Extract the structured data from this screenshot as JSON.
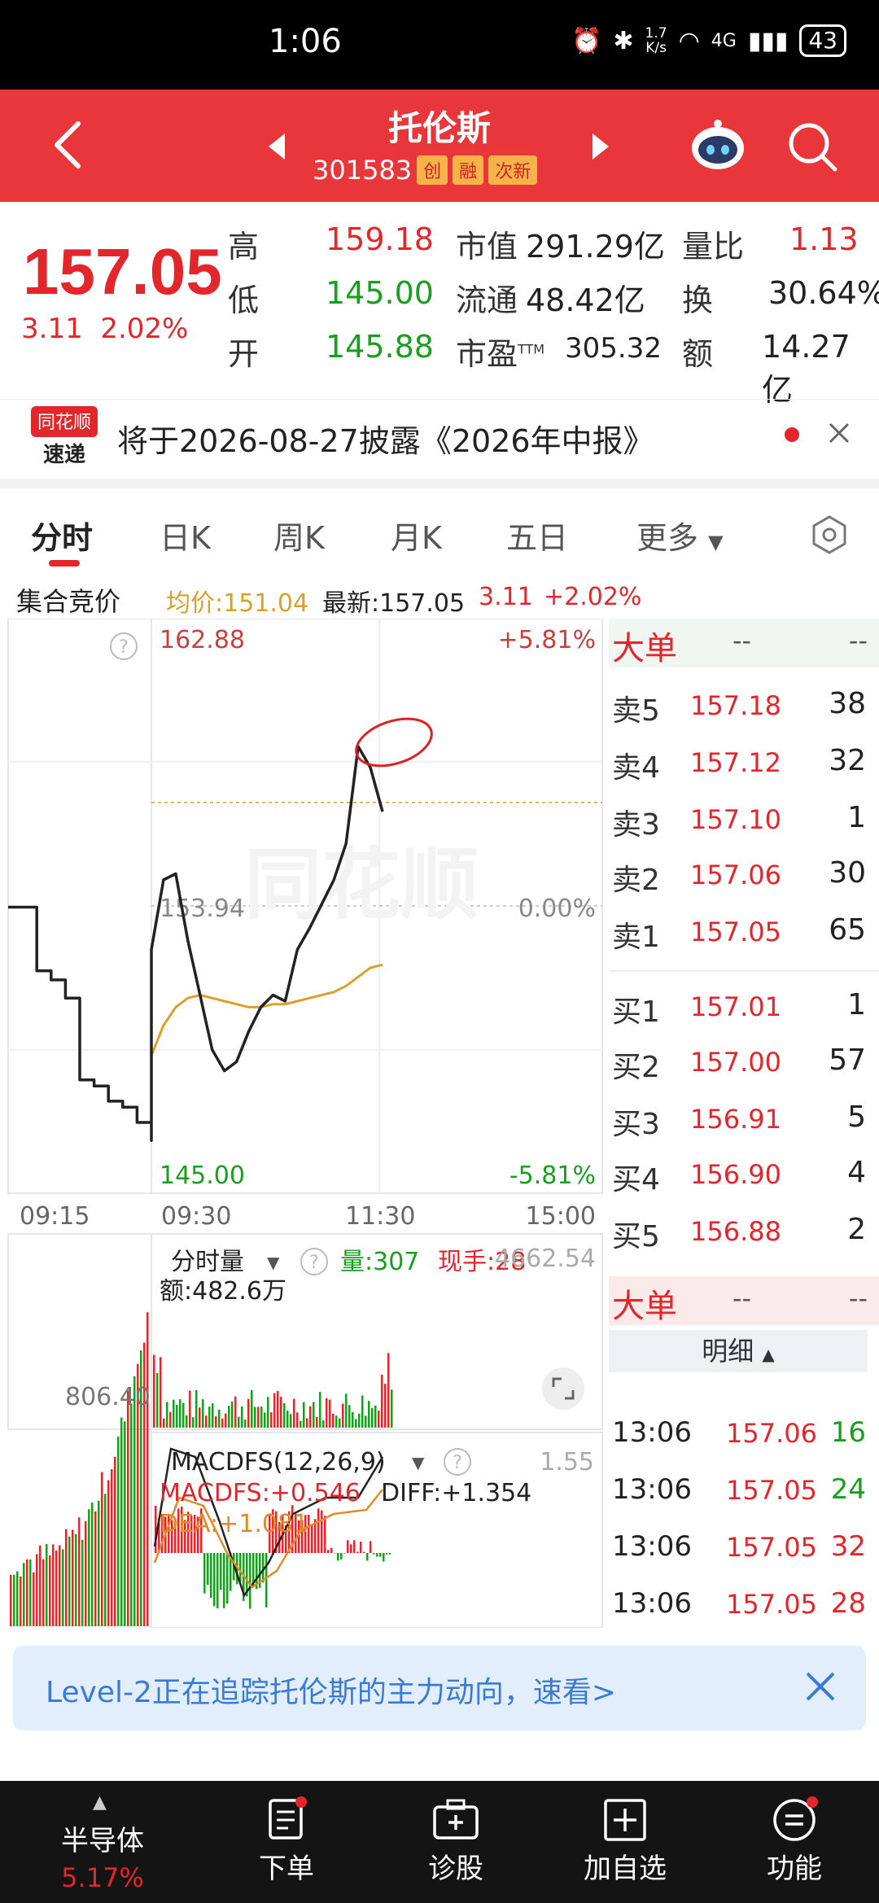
{
  "status_bar": {
    "time": "1:06",
    "speed_value": "1.7",
    "speed_unit": "K/s",
    "network": "4G",
    "battery": "43"
  },
  "header": {
    "title": "托伦斯",
    "code": "301583",
    "tags": [
      "创",
      "融",
      "次新"
    ]
  },
  "quote": {
    "price": "157.05",
    "change": "3.11",
    "change_pct": "2.02%",
    "fields": [
      {
        "label": "高",
        "value": "159.18"
      },
      {
        "label": "低",
        "value": "145.00"
      },
      {
        "label": "开",
        "value": "145.88"
      },
      {
        "label": "市值",
        "value": "291.29亿"
      },
      {
        "label": "流通",
        "value": "48.42亿"
      },
      {
        "label": "市盈",
        "sup": "TTM",
        "value": "305.32"
      },
      {
        "label": "量比",
        "value": "1.13"
      },
      {
        "label": "换",
        "value": "30.64%"
      },
      {
        "label": "额",
        "value": "14.27亿"
      }
    ]
  },
  "notice": {
    "logo_line1": "同花顺",
    "logo_line2": "速递",
    "text": "将于2026-08-27披露《2026年中报》"
  },
  "tabs": [
    "分时",
    "日K",
    "周K",
    "月K",
    "五日",
    "更多"
  ],
  "info_row": {
    "label": "集合竞价",
    "avg_label": "均价:151.04",
    "latest_label": "最新:157.05",
    "change": "3.11",
    "change_pct": "+2.02%"
  },
  "chart_data": {
    "type": "line",
    "title": "",
    "ylim": [
      145.0,
      162.88
    ],
    "ticks": {
      "y_top": "162.88",
      "y_mid": "153.94",
      "y_bot": "145.00",
      "pct_top": "+5.81%",
      "pct_mid": "0.00%",
      "pct_bot": "-5.81%"
    },
    "x_labels": [
      "09:15",
      "09:30",
      "11:30",
      "15:00"
    ],
    "watermark": "同花顺",
    "volume_panel": {
      "label": "分时量",
      "vol": "量:307",
      "now_hand": "现手:28",
      "amount": "额:482.6万",
      "ymax": "4662.54",
      "auction_level": "806.40"
    },
    "macd_panel": {
      "label": "MACDFS(12,26,9)",
      "macd": "MACDFS:+0.546",
      "diff": "DIFF:+1.354",
      "dea": "DEA:+1.081",
      "ymax": "1.55"
    },
    "price_series": [
      153.9,
      153.9,
      151.8,
      151.5,
      150.9,
      148.2,
      148.0,
      147.5,
      147.3,
      146.8,
      146.2,
      152.5,
      154.8,
      155.0,
      152.8,
      151.0,
      149.2,
      148.5,
      148.8,
      149.8,
      150.6,
      151.0,
      150.8,
      152.5,
      153.2,
      154.0,
      154.8,
      156.0,
      159.2,
      158.5,
      157.05
    ],
    "avg_series": [
      null,
      null,
      null,
      null,
      null,
      null,
      null,
      null,
      null,
      null,
      null,
      149.0,
      150.0,
      150.6,
      150.9,
      151.0,
      150.9,
      150.8,
      150.7,
      150.6,
      150.6,
      150.7,
      150.7,
      150.8,
      150.9,
      151.0,
      151.1,
      151.3,
      151.6,
      151.9,
      152.0
    ]
  },
  "book": {
    "big_order_label": "大单",
    "placeholder": "--",
    "asks": [
      {
        "label": "卖5",
        "price": "157.18",
        "vol": "38"
      },
      {
        "label": "卖4",
        "price": "157.12",
        "vol": "32"
      },
      {
        "label": "卖3",
        "price": "157.10",
        "vol": "1"
      },
      {
        "label": "卖2",
        "price": "157.06",
        "vol": "30"
      },
      {
        "label": "卖1",
        "price": "157.05",
        "vol": "65"
      }
    ],
    "bids": [
      {
        "label": "买1",
        "price": "157.01",
        "vol": "1"
      },
      {
        "label": "买2",
        "price": "157.00",
        "vol": "57"
      },
      {
        "label": "买3",
        "price": "156.91",
        "vol": "5"
      },
      {
        "label": "买4",
        "price": "156.90",
        "vol": "4"
      },
      {
        "label": "买5",
        "price": "156.88",
        "vol": "2"
      }
    ],
    "detail_label": "明细",
    "ticks": [
      {
        "time": "13:06",
        "price": "157.06",
        "vol": "16",
        "dir": "buy"
      },
      {
        "time": "13:06",
        "price": "157.05",
        "vol": "24",
        "dir": "buy"
      },
      {
        "time": "13:06",
        "price": "157.05",
        "vol": "32",
        "dir": "sell"
      },
      {
        "time": "13:06",
        "price": "157.05",
        "vol": "28",
        "dir": "sell"
      }
    ]
  },
  "banner": {
    "text": "Level-2正在追踪托伦斯的主力动向，速看>"
  },
  "bottom_nav": [
    {
      "label": "半导体",
      "sub": "5.17%"
    },
    {
      "label": "下单"
    },
    {
      "label": "诊股"
    },
    {
      "label": "加自选"
    },
    {
      "label": "功能"
    }
  ],
  "colors": {
    "header": "#e8363b",
    "up": "#e3262b",
    "down": "#1a9e1f",
    "avg_line": "#d9a12a"
  }
}
